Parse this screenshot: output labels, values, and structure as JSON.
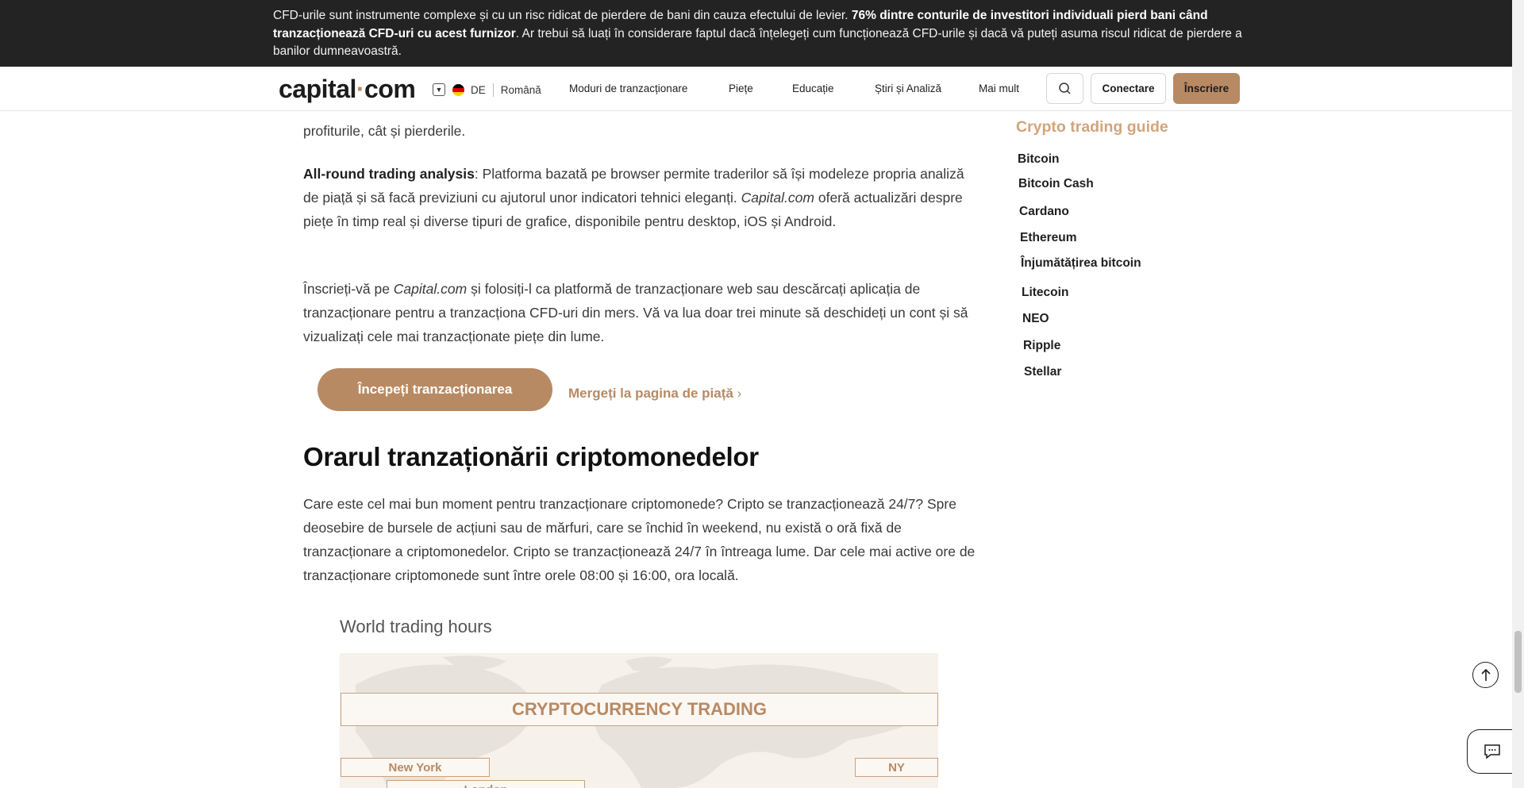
{
  "risk_banner": {
    "part1": "CFD-urile sunt instrumente complexe și cu un risc ridicat de pierdere de bani din cauza efectului de levier. ",
    "bold": "76% dintre conturile de investitori individuali pierd bani când tranzacționează CFD-uri cu acest furnizor",
    "part2": ". Ar trebui să luați în considerare faptul dacă înțelegeți cum funcționează CFD-urile și dacă vă puteți asuma riscul ridicat de pierdere a banilor dumneavoastră."
  },
  "header": {
    "logo_main": "capital",
    "logo_dot": "·",
    "logo_suffix": "com",
    "lang_code": "DE",
    "language": "Română",
    "nav": [
      "Moduri de tranzacționare",
      "Piețe",
      "Educație",
      "Știri și Analiză",
      "Mai mult"
    ],
    "login": "Conectare",
    "signup": "Înscriere"
  },
  "article": {
    "p0_line": "profiturile, cât și pierderile.",
    "p1_bold": "All-round trading analysis",
    "p1_text": ": Platforma bazată pe browser permite traderilor să își modeleze propria analiză de piață și să facă previziuni cu ajutorul unor indicatori tehnici eleganți. ",
    "p1_em": "Capital.com",
    "p1_text2": " oferă actualizări despre piețe în timp real și diverse tipuri de grafice, disponibile pentru desktop, iOS și Android.",
    "p2_text1": "Înscrieți-vă pe ",
    "p2_em": "Capital.com",
    "p2_text2": " și folosiți-l ca platformă de tranzacționare web sau descărcați aplicația de tranzacționare pentru a tranzacționa CFD-uri din mers. Vă va lua doar trei minute să deschideți un cont și să vizualizați cele mai tranzacționate piețe din lume.",
    "cta_button": "Începeți tranzacționarea",
    "cta_link": "Mergeți la pagina de piață",
    "heading": "Orarul tranzaționării criptomonedelor",
    "p3": "Care este cel mai bun moment pentru tranzacționare criptomonede? Cripto se tranzacționează 24/7? Spre deosebire de bursele de acțiuni sau de mărfuri, care se închid în weekend, nu există o oră fixă de tranzacționare a criptomonedelor. Cripto se tranzacționează 24/7 în întreaga lume. Dar cele mai active ore de tranzacționare criptomonede sunt între orele 08:00 și 16:00, ora locală."
  },
  "infographic": {
    "title": "World trading hours",
    "banner": "CRYPTOCURRENCY TRADING",
    "cities": [
      "New York",
      "NY",
      "London"
    ]
  },
  "sidebar": {
    "title": "Crypto trading guide",
    "items": [
      "Bitcoin",
      "Bitcoin Cash",
      "Cardano",
      "Ethereum",
      "Înjumătățirea bitcoin",
      "Litecoin",
      "NEO",
      "Ripple",
      "Stellar"
    ]
  },
  "colors": {
    "accent": "#b88a63",
    "banner_bg": "#232323",
    "sidebar_title": "#d3a47c"
  },
  "icons": {
    "search": "search-icon",
    "scroll_top": "arrow-up-icon",
    "chat": "chat-icon",
    "lang_dropdown": "chevron-down-icon",
    "flag": "german-flag-icon"
  }
}
